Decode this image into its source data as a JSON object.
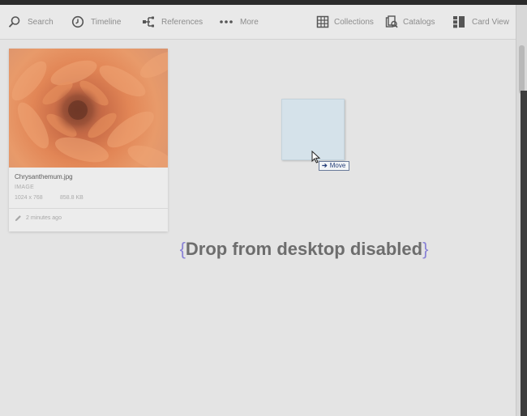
{
  "toolbar": {
    "left": [
      {
        "label": "Search",
        "icon": "search-icon"
      },
      {
        "label": "Timeline",
        "icon": "clock-icon"
      },
      {
        "label": "References",
        "icon": "references-icon"
      },
      {
        "label": "More",
        "icon": "more-icon"
      }
    ],
    "right": [
      {
        "label": "Collections",
        "icon": "collections-icon"
      },
      {
        "label": "Catalogs",
        "icon": "catalogs-icon"
      },
      {
        "label": "Card View",
        "icon": "card-view-icon"
      }
    ]
  },
  "card": {
    "title": "Chrysanthemum.jpg",
    "type": "IMAGE",
    "dimensions": "1024 x 768",
    "size": "858.8 KB",
    "modified": "2 minutes ago"
  },
  "drag": {
    "badge_label": "Move"
  },
  "drop_message": {
    "open_brace": "{",
    "text": "Drop from desktop disabled",
    "close_brace": "}"
  },
  "colors": {
    "toolbar_bg": "#e9e9e9",
    "content_bg": "#e4e4e4",
    "brace": "#8a83d6",
    "thumb": "#e28656"
  }
}
